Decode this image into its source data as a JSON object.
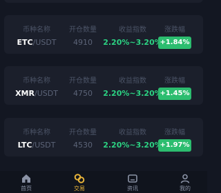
{
  "headers": {
    "pair": "币种名称",
    "position_qty": "开仓数量",
    "yield": "收益指数",
    "change": "涨跌幅"
  },
  "items": [
    {
      "base": "ETC",
      "quote": "/USDT",
      "qty": "4910",
      "range": "2.20%~3.20%",
      "change": "+1.84%"
    },
    {
      "base": "XMR",
      "quote": "/USDT",
      "qty": "4750",
      "range": "2.20%~3.20%",
      "change": "+1.45%"
    },
    {
      "base": "LTC",
      "quote": "/USDT",
      "qty": "4530",
      "range": "2.20%~3.20%",
      "change": "+1.97%"
    }
  ],
  "tabbar": {
    "home": "首页",
    "trade": "交易",
    "news": "资讯",
    "mine": "我的",
    "active": "trade"
  },
  "colors": {
    "background": "#131722",
    "card": "#1b1f2b",
    "up_green": "#2cbd6f",
    "range_text": "#2cd383",
    "active_tab": "#e8b43a"
  }
}
